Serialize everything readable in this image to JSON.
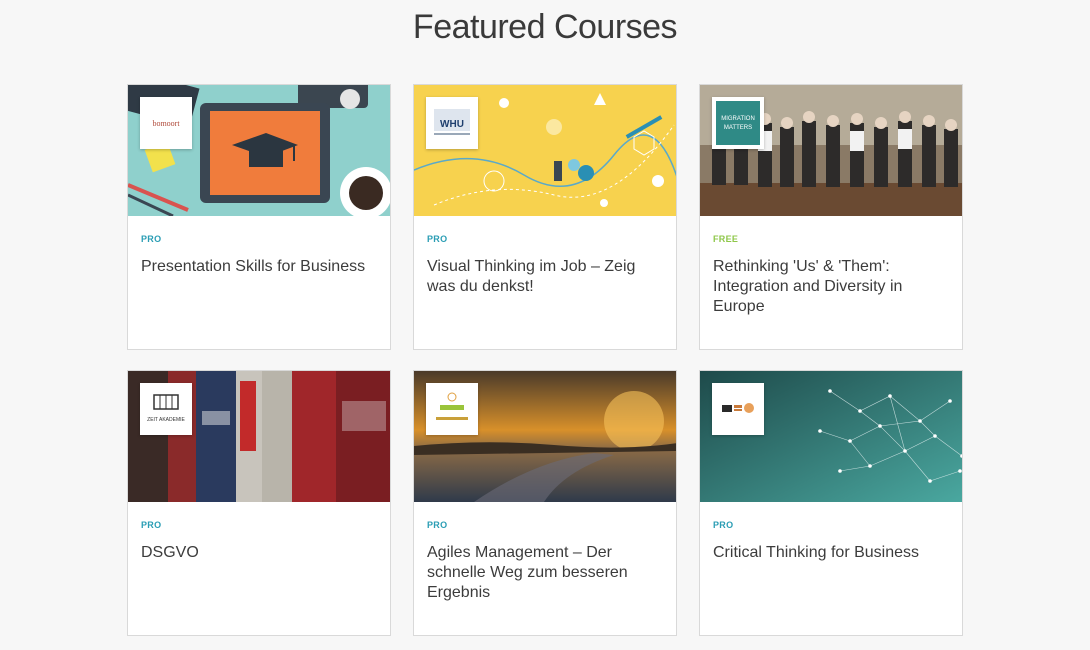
{
  "page": {
    "title": "Featured Courses"
  },
  "courses": [
    {
      "badge": "PRO",
      "title": "Presentation Skills for Business",
      "logo_text": "bomoort",
      "image": "tablet-graduation-cap-illustration"
    },
    {
      "badge": "PRO",
      "title": "Visual Thinking im Job – Zeig was du denkst!",
      "logo_text": "WHU",
      "image": "yellow-doodle-map-illustration"
    },
    {
      "badge": "FREE",
      "title": "Rethinking 'Us' & 'Them': Integration and Diversity in Europe",
      "logo_text": "MIGRATION MATTERS",
      "image": "group-photo-in-hall"
    },
    {
      "badge": "PRO",
      "title": "DSGVO",
      "logo_text": "ZEIT AKADEMIE",
      "image": "law-books-on-shelf"
    },
    {
      "badge": "PRO",
      "title": "Agiles Management – Der schnelle Weg zum besseren Ergebnis",
      "logo_text": "",
      "image": "sunset-field-road"
    },
    {
      "badge": "PRO",
      "title": "Critical Thinking for Business",
      "logo_text": "",
      "image": "teal-network-nodes"
    }
  ],
  "colors": {
    "pro_badge": "#2a9db4",
    "free_badge": "#8fc74a",
    "background": "#f7f7f7"
  }
}
